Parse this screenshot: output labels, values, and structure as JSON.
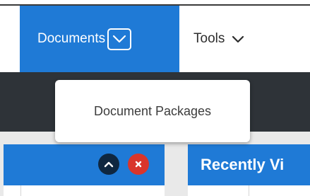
{
  "nav": {
    "documents_label": "Documents",
    "tools_label": "Tools"
  },
  "menu": {
    "items": [
      {
        "label": "Document Packages"
      }
    ]
  },
  "panels": {
    "right_title": "Recently Vi"
  },
  "colors": {
    "accent_blue": "#1f7ad6",
    "dark_bar": "#2e3338",
    "close_red": "#d9352b",
    "collapse_navy": "#0f2740"
  },
  "icons": {
    "documents_dropdown": "chevron-down-icon",
    "tools_dropdown": "chevron-down-icon",
    "collapse": "chevron-up-icon",
    "close": "close-icon"
  }
}
